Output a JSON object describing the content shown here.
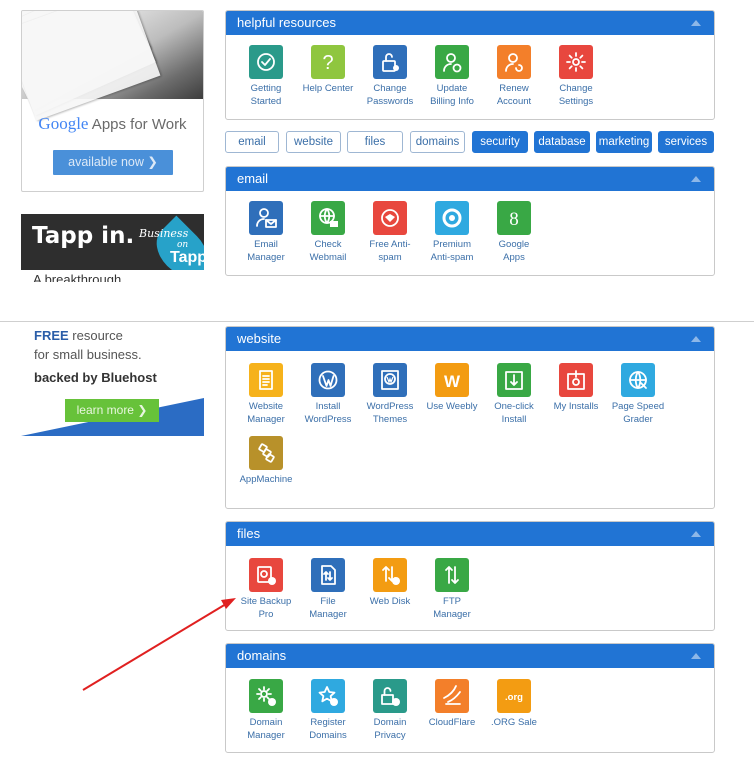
{
  "colors": {
    "header": "#2174d4",
    "link": "#3b6fa8",
    "panel_border": "#c9c9c9",
    "annotation_arrow": "#e02020"
  },
  "ads": {
    "google": {
      "brand_g": "Google",
      "brand_rest": " Apps for Work",
      "button": "available now  ❯"
    },
    "tapp": {
      "headline": "Tapp in.",
      "script": "Business",
      "on": "on",
      "tapp": "Tapp",
      "tail": "A breakthrough"
    },
    "bluehost": {
      "free": "FREE",
      "line1_rest": " resource",
      "line2": "for small business.",
      "line3": "backed by Bluehost",
      "button": "learn more  ❯"
    }
  },
  "panels": {
    "helpful": {
      "title": "helpful resources",
      "items": [
        {
          "label1": "Getting",
          "label2": "Started",
          "icon": "check-circle",
          "color": "#2a9a8a"
        },
        {
          "label1": "Help Center",
          "label2": "",
          "icon": "question-mark",
          "color": "#8fc63f"
        },
        {
          "label1": "Change",
          "label2": "Passwords",
          "icon": "padlock",
          "color": "#2f6fba"
        },
        {
          "label1": "Update",
          "label2": "Billing Info",
          "icon": "user-gear",
          "color": "#39a845"
        },
        {
          "label1": "Renew",
          "label2": "Account",
          "icon": "user-refresh",
          "color": "#f37f2a"
        },
        {
          "label1": "Change",
          "label2": "Settings",
          "icon": "gear",
          "color": "#e8473e"
        }
      ]
    },
    "email": {
      "title": "email",
      "items": [
        {
          "label1": "Email",
          "label2": "Manager",
          "icon": "user-envelope",
          "color": "#2f6fba"
        },
        {
          "label1": "Check",
          "label2": "Webmail",
          "icon": "globe-envelope",
          "color": "#39a845"
        },
        {
          "label1": "Free Anti-",
          "label2": "spam",
          "icon": "shield-badge",
          "color": "#e8473e"
        },
        {
          "label1": "Premium",
          "label2": "Anti-spam",
          "icon": "ring",
          "color": "#2fa9e0"
        },
        {
          "label1": "Google",
          "label2": "Apps",
          "icon": "google-g",
          "color": "#39a845"
        }
      ]
    },
    "website": {
      "title": "website",
      "items": [
        {
          "label1": "Website",
          "label2": "Manager",
          "icon": "document",
          "color": "#f6b21b"
        },
        {
          "label1": "Install",
          "label2": "WordPress",
          "icon": "wordpress",
          "color": "#2f6fba"
        },
        {
          "label1": "WordPress",
          "label2": "Themes",
          "icon": "wordpress-frame",
          "color": "#2f6fba"
        },
        {
          "label1": "Use Weebly",
          "label2": "",
          "icon": "weebly-w",
          "color": "#f39c12"
        },
        {
          "label1": "One-click",
          "label2": "Install",
          "icon": "install-box",
          "color": "#39a845"
        },
        {
          "label1": "My Installs",
          "label2": "",
          "icon": "installs-box",
          "color": "#e8473e"
        },
        {
          "label1": "Page Speed",
          "label2": "Grader",
          "icon": "globe-arrow",
          "color": "#2fa9e0"
        },
        {
          "label1": "AppMachine",
          "label2": "",
          "icon": "appmachine",
          "color": "#b8912a"
        }
      ]
    },
    "files": {
      "title": "files",
      "items": [
        {
          "label1": "Site Backup",
          "label2": "Pro",
          "icon": "backup-clock",
          "color": "#e8473e"
        },
        {
          "label1": "File",
          "label2": "Manager",
          "icon": "file-arrows",
          "color": "#2f6fba"
        },
        {
          "label1": "Web Disk",
          "label2": "",
          "icon": "disk-globe",
          "color": "#f39c12"
        },
        {
          "label1": "FTP",
          "label2": "Manager",
          "icon": "up-down-arrows",
          "color": "#39a845"
        }
      ]
    },
    "domains": {
      "title": "domains",
      "items": [
        {
          "label1": "Domain",
          "label2": "Manager",
          "icon": "gear-globe",
          "color": "#39a845"
        },
        {
          "label1": "Register",
          "label2": "Domains",
          "icon": "star-globe",
          "color": "#2fa9e0"
        },
        {
          "label1": "Domain",
          "label2": "Privacy",
          "icon": "padlock-globe",
          "color": "#2a9a8a"
        },
        {
          "label1": "CloudFlare",
          "label2": "",
          "icon": "cloudflare",
          "color": "#f37f2a"
        },
        {
          "label1": ".ORG Sale",
          "label2": "",
          "icon": "org-badge",
          "color": "#f39c12"
        }
      ]
    }
  },
  "tabs": [
    {
      "label": "email",
      "style": "outline"
    },
    {
      "label": "website",
      "style": "outline"
    },
    {
      "label": "files",
      "style": "outline"
    },
    {
      "label": "domains",
      "style": "outline"
    },
    {
      "label": "security",
      "style": "solid"
    },
    {
      "label": "database",
      "style": "solid"
    },
    {
      "label": "marketing",
      "style": "solid"
    },
    {
      "label": "services",
      "style": "solid"
    }
  ],
  "org_badge_text": ".org",
  "weebly_letter": "W",
  "google_letter": "8",
  "help_letter": "?"
}
